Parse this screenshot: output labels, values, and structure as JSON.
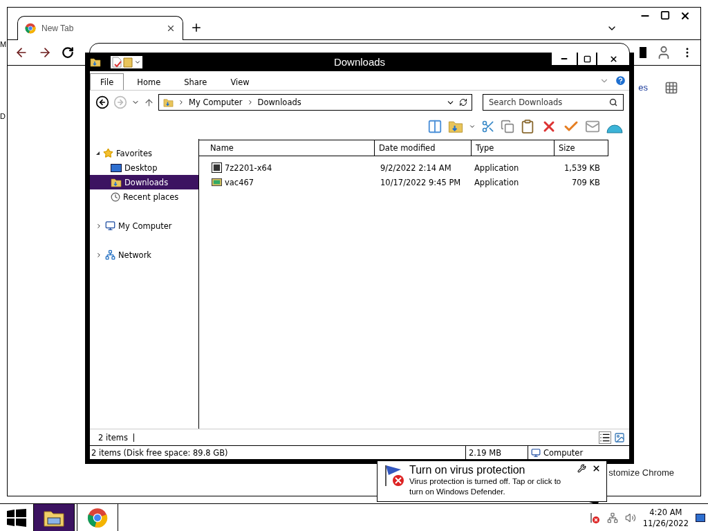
{
  "desktop_fragments": [
    "M",
    "D"
  ],
  "browser": {
    "tabs": [
      {
        "label": "New Tab",
        "selected": true
      }
    ],
    "shortcut_label": "es",
    "customize_label": "stomize Chrome"
  },
  "explorer": {
    "title": "Downloads",
    "ribbon_tabs": [
      {
        "label": "File",
        "selected": true
      },
      {
        "label": "Home",
        "selected": false
      },
      {
        "label": "Share",
        "selected": false
      },
      {
        "label": "View",
        "selected": false
      }
    ],
    "breadcrumb": [
      "My Computer",
      "Downloads"
    ],
    "search": {
      "placeholder": "Search Downloads"
    },
    "nav": [
      {
        "label": "Favorites",
        "kind": "star",
        "expanded": true,
        "selected": false,
        "children": [
          {
            "label": "Desktop",
            "kind": "desktop",
            "selected": false
          },
          {
            "label": "Downloads",
            "kind": "download",
            "selected": true
          },
          {
            "label": "Recent places",
            "kind": "recent",
            "selected": false
          }
        ]
      },
      {
        "label": "My Computer",
        "kind": "computer",
        "expanded": false,
        "selected": false
      },
      {
        "label": "Network",
        "kind": "network",
        "expanded": false,
        "selected": false
      }
    ],
    "columns": [
      "Name",
      "Date modified",
      "Type",
      "Size"
    ],
    "rows": [
      {
        "name": "7z2201-x64",
        "kind": "archive",
        "date": "9/2/2022 2:14 AM",
        "type": "Application",
        "size": "1,539 KB"
      },
      {
        "name": "vac467",
        "kind": "setup",
        "date": "10/17/2022 9:45 PM",
        "type": "Application",
        "size": "709 KB"
      }
    ],
    "item_count": "2 items",
    "status": {
      "summary": "2 items (Disk free space: 89.8 GB)",
      "size": "2.19 MB",
      "location": "Computer"
    }
  },
  "notification": {
    "title": "Turn on virus protection",
    "body": "Virus protection is turned off. Tap or click to turn on Windows Defender."
  },
  "taskbar": {
    "apps": [
      {
        "kind": "explorer",
        "selected": true
      },
      {
        "kind": "chrome",
        "selected": false
      }
    ],
    "time": "4:20 AM",
    "date": "11/26/2022"
  }
}
